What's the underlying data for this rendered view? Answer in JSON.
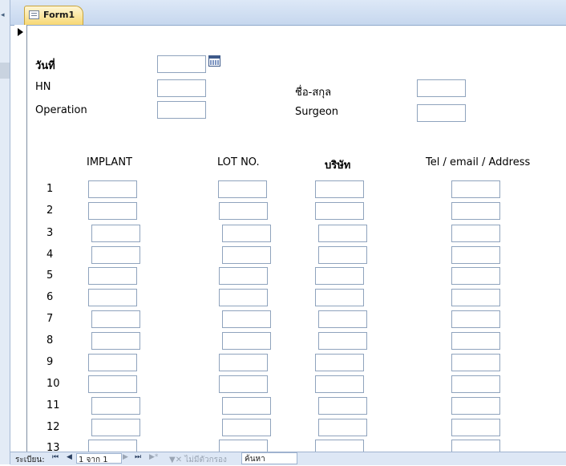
{
  "window": {
    "tab_title": "Form1"
  },
  "form": {
    "date_label": "วันที่",
    "hn_label": "HN",
    "operation_label": "Operation",
    "name_label": "ชื่อ-สกุล",
    "surgeon_label": "Surgeon",
    "col_implant": "IMPLANT",
    "col_lot": "LOT NO.",
    "col_company": "บริษัท",
    "col_contact": "Tel / email / Address",
    "rows": [
      "1",
      "2",
      "3",
      "4",
      "5",
      "6",
      "7",
      "8",
      "9",
      "10",
      "11",
      "12",
      "13"
    ]
  },
  "navbar": {
    "record_label": "ระเบียน:",
    "record_value": "1 จาก 1",
    "filter_label": "ไม่มีตัวกรอง",
    "search_label": "ค้นหา",
    "first": "⏮",
    "prev": "◀",
    "next": "▶",
    "last": "⏭",
    "new": "▶*"
  },
  "colors": {
    "accent_tab": "#f7d874",
    "field_border": "#8fa3bd",
    "chrome": "#dde8f7"
  }
}
